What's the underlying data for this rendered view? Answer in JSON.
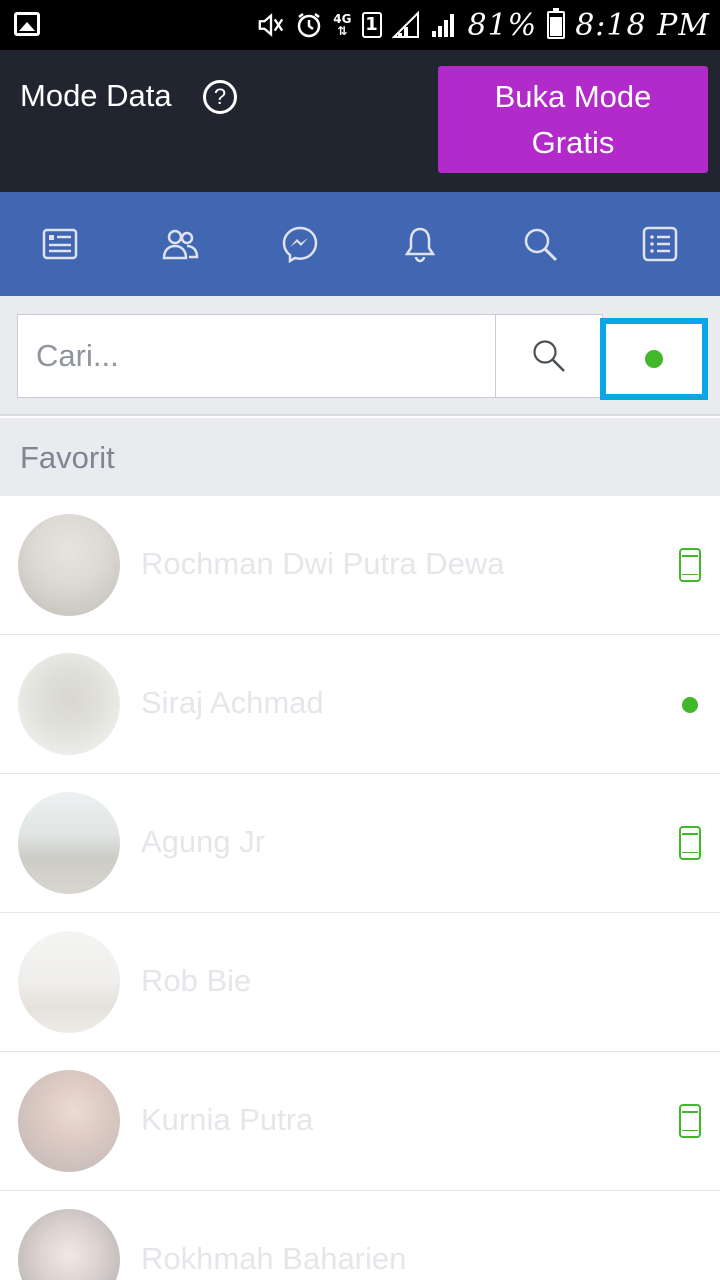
{
  "status_bar": {
    "battery": "81%",
    "time": "8:18 PM",
    "network": "4G",
    "sim": "1",
    "icons": [
      "gallery-icon",
      "mute-icon",
      "alarm-icon",
      "network-4g-icon",
      "sim-icon",
      "signal-icon",
      "signal-icon",
      "battery-icon"
    ]
  },
  "header": {
    "title": "Mode Data",
    "help_symbol": "?",
    "free_mode_button": "Buka Mode\nGratis",
    "background": "#21252f",
    "button_color": "#b22ac9"
  },
  "navbar": {
    "color": "#4267b2",
    "items": [
      {
        "icon": "news-feed-icon"
      },
      {
        "icon": "friends-icon"
      },
      {
        "icon": "messenger-icon"
      },
      {
        "icon": "notifications-icon"
      },
      {
        "icon": "search-icon"
      },
      {
        "icon": "menu-icon"
      }
    ]
  },
  "search": {
    "placeholder": "Cari...",
    "active_filter_highlight": "#0aa6e8"
  },
  "section": {
    "title": "Favorit"
  },
  "contacts": [
    {
      "name": "Rochman Dwi Putra Dewa",
      "status": "mobile"
    },
    {
      "name": "Siraj Achmad",
      "status": "online"
    },
    {
      "name": "Agung Jr",
      "status": "mobile"
    },
    {
      "name": "Rob Bie",
      "status": "none"
    },
    {
      "name": "Kurnia Putra",
      "status": "mobile"
    },
    {
      "name": "Rokhmah Baharien",
      "status": "none"
    }
  ],
  "colors": {
    "online_green": "#42b72a"
  }
}
